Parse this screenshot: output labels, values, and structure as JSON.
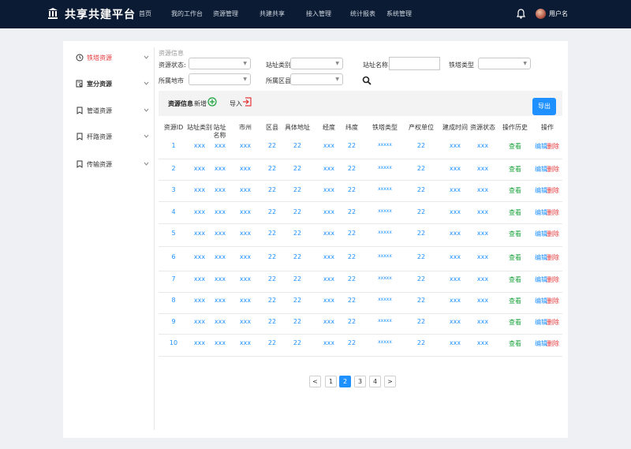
{
  "header": {
    "brand": "共享共建平台",
    "nav": [
      "首页",
      "我的工作台",
      "资源管理",
      "共建共享",
      "接入管理",
      "统计报表",
      "系统管理"
    ],
    "username": "用户名"
  },
  "sidebar": {
    "items": [
      {
        "label": "铁塔资源",
        "icon": "clock-icon"
      },
      {
        "label": "室分资源",
        "icon": "document-search-icon"
      },
      {
        "label": "管道资源",
        "icon": "bookmark-icon"
      },
      {
        "label": "杆路资源",
        "icon": "bookmark-icon"
      },
      {
        "label": "传输资源",
        "icon": "bookmark-icon"
      }
    ]
  },
  "filters": {
    "section_title": "资源信息",
    "status_label": "资源状态:",
    "site_type_label": "站址类别",
    "site_name_label": "站址名称",
    "tower_type_label": "铁塔类型",
    "city_label": "所属地市",
    "county_label": "所属区县"
  },
  "toolbar": {
    "title": "资源信息",
    "add_label": "新增",
    "import_label": "导入",
    "export_label": "导出"
  },
  "table": {
    "headers": [
      "资源ID",
      "站址类别",
      "站址名称",
      "市州",
      "区县",
      "具体地址",
      "经度",
      "纬度",
      "铁塔类型",
      "产权单位",
      "建成时间",
      "资源状态",
      "操作历史",
      "操作"
    ],
    "rows": [
      {
        "id": "1",
        "type": "xxx",
        "name": "xxx",
        "city": "xxx",
        "county": "22",
        "addr": "22",
        "lng": "xxx",
        "lat": "22",
        "tower": "xxxxx",
        "owner": "22",
        "built": "xxx",
        "status": "xxx",
        "history": "查看",
        "edit": "编辑",
        "del": "删除"
      },
      {
        "id": "2",
        "type": "xxx",
        "name": "xxx",
        "city": "xxx",
        "county": "22",
        "addr": "22",
        "lng": "xxx",
        "lat": "22",
        "tower": "xxxxx",
        "owner": "22",
        "built": "xxx",
        "status": "xxx",
        "history": "查看",
        "edit": "编辑",
        "del": "删除"
      },
      {
        "id": "3",
        "type": "xxx",
        "name": "xxx",
        "city": "xxx",
        "county": "22",
        "addr": "22",
        "lng": "xxx",
        "lat": "22",
        "tower": "xxxxx",
        "owner": "22",
        "built": "xxx",
        "status": "xxx",
        "history": "查看",
        "edit": "编辑",
        "del": "删除"
      },
      {
        "id": "4",
        "type": "xxx",
        "name": "xxx",
        "city": "xxx",
        "county": "22",
        "addr": "22",
        "lng": "xxx",
        "lat": "22",
        "tower": "xxxxx",
        "owner": "22",
        "built": "xxx",
        "status": "xxx",
        "history": "查看",
        "edit": "编辑",
        "del": "删除"
      },
      {
        "id": "5",
        "type": "xxx",
        "name": "xxx",
        "city": "xxx",
        "county": "22",
        "addr": "22",
        "lng": "xxx",
        "lat": "22",
        "tower": "xxxxx",
        "owner": "22",
        "built": "xxx",
        "status": "xxx",
        "history": "查看",
        "edit": "编辑",
        "del": "删除"
      },
      {
        "id": "6",
        "type": "xxx",
        "name": "xxx",
        "city": "xxx",
        "county": "22",
        "addr": "22",
        "lng": "xxx",
        "lat": "22",
        "tower": "xxxxx",
        "owner": "22",
        "built": "xxx",
        "status": "xxx",
        "history": "查看",
        "edit": "编辑",
        "del": "删除"
      },
      {
        "id": "7",
        "type": "xxx",
        "name": "xxx",
        "city": "xxx",
        "county": "22",
        "addr": "22",
        "lng": "xxx",
        "lat": "22",
        "tower": "xxxxx",
        "owner": "22",
        "built": "xxx",
        "status": "xxx",
        "history": "查看",
        "edit": "编辑",
        "del": "删除"
      },
      {
        "id": "8",
        "type": "xxx",
        "name": "xxx",
        "city": "xxx",
        "county": "22",
        "addr": "22",
        "lng": "xxx",
        "lat": "22",
        "tower": "xxxxx",
        "owner": "22",
        "built": "xxx",
        "status": "xxx",
        "history": "查看",
        "edit": "编辑",
        "del": "删除"
      },
      {
        "id": "9",
        "type": "xxx",
        "name": "xxx",
        "city": "xxx",
        "county": "22",
        "addr": "22",
        "lng": "xxx",
        "lat": "22",
        "tower": "xxxxx",
        "owner": "22",
        "built": "xxx",
        "status": "xxx",
        "history": "查看",
        "edit": "编辑",
        "del": "删除"
      },
      {
        "id": "10",
        "type": "xxx",
        "name": "xxx",
        "city": "xxx",
        "county": "22",
        "addr": "22",
        "lng": "xxx",
        "lat": "22",
        "tower": "xxxxx",
        "owner": "22",
        "built": "xxx",
        "status": "xxx",
        "history": "查看",
        "edit": "编辑",
        "del": "删除"
      }
    ]
  },
  "pagination": {
    "prev": "<",
    "next": ">",
    "pages": [
      "1",
      "2",
      "3",
      "4"
    ],
    "current": "2"
  },
  "colors": {
    "navbar": "#0b1b33",
    "accent": "#1e90ff",
    "active_menu": "#e4393c",
    "view_link": "#19a23b",
    "delete_link": "#e4393c"
  }
}
